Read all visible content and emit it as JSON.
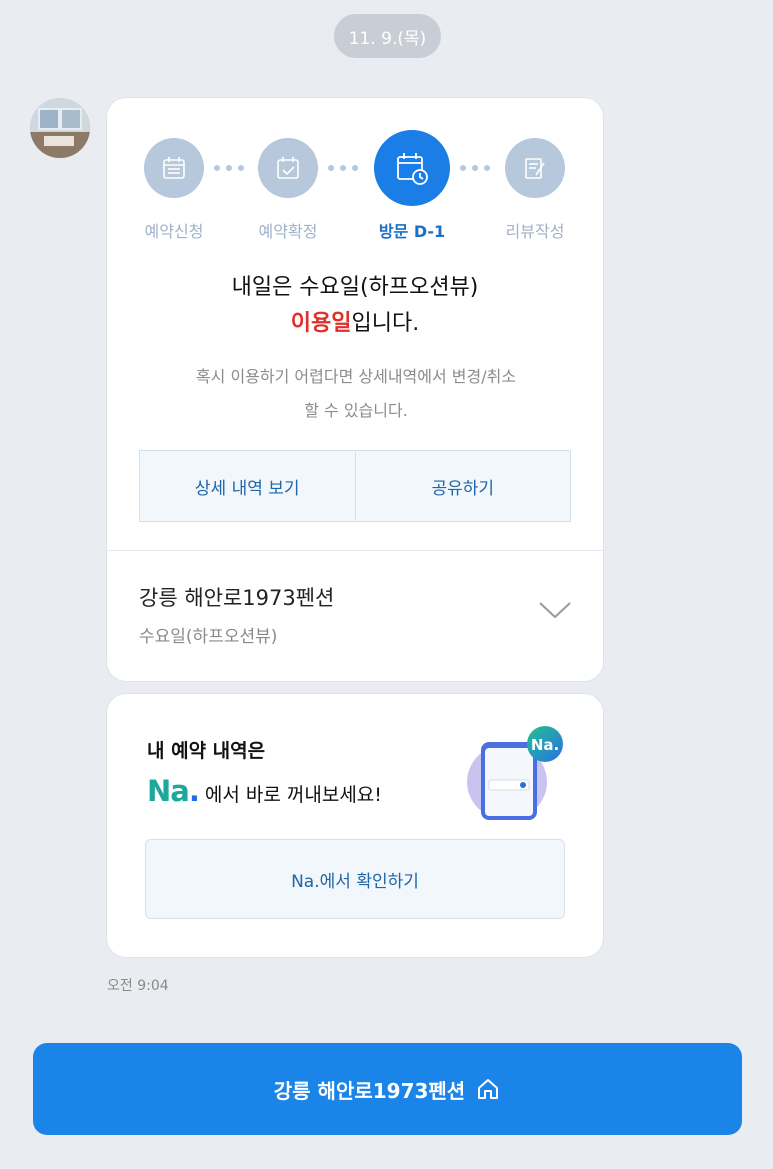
{
  "date_label": "11. 9.(목)",
  "steps": [
    {
      "label": "예약신청",
      "icon": "calendar-grid-icon",
      "active": false
    },
    {
      "label": "예약확정",
      "icon": "calendar-check-icon",
      "active": false
    },
    {
      "label": "방문 D-1",
      "icon": "calendar-clock-icon",
      "active": true
    },
    {
      "label": "리뷰작성",
      "icon": "edit-note-icon",
      "active": false
    }
  ],
  "notice": {
    "line1": "내일은 수요일(하프오션뷰)",
    "line2_highlight": "이용일",
    "line2_rest": "입니다.",
    "sub_line1": "혹시 이용하기 어렵다면 상세내역에서 변경/취소",
    "sub_line2": "할 수 있습니다."
  },
  "buttons": {
    "details": "상세 내역 보기",
    "share": "공유하기"
  },
  "place": {
    "name": "강릉 해안로1973펜션",
    "room": "수요일(하프오션뷰)"
  },
  "promo": {
    "title": "내 예약 내역은",
    "logo": "Na",
    "logo_dot": ".",
    "subtitle": "에서 바로 꺼내보세요!",
    "badge": "Na.",
    "button": "Na.에서 확인하기"
  },
  "time": "오전 9:04",
  "bottom_button": "강릉 해안로1973펜션",
  "colors": {
    "accent": "#1a84e8",
    "highlight": "#e0302a",
    "step_inactive": "#b7c7dc"
  }
}
